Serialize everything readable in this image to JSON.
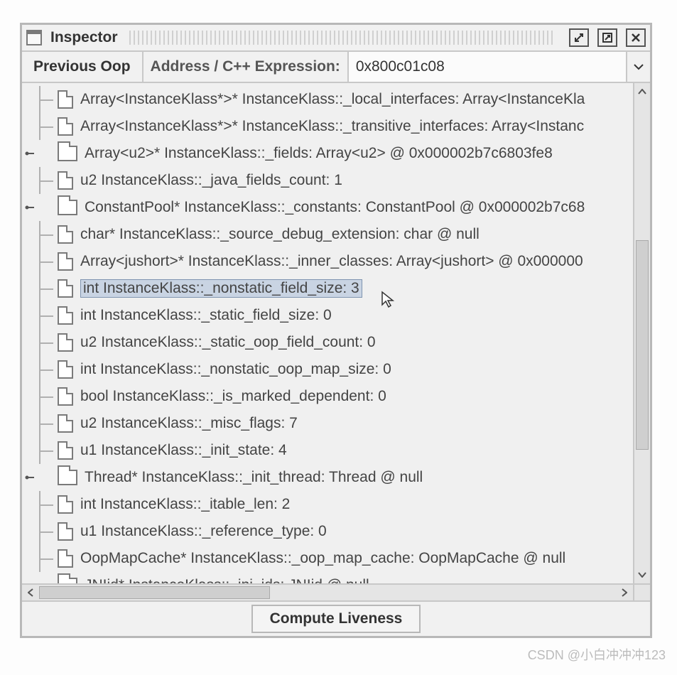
{
  "window": {
    "title": "Inspector"
  },
  "toolbar": {
    "prev_label": "Previous Oop",
    "addr_label": "Address / C++ Expression:",
    "addr_value": "0x800c01c08"
  },
  "tree": {
    "nodes": [
      {
        "icon": "file",
        "expandable": false,
        "selected": false,
        "label": "Array<InstanceKlass*>* InstanceKlass::_local_interfaces: Array<InstanceKla"
      },
      {
        "icon": "file",
        "expandable": false,
        "selected": false,
        "label": "Array<InstanceKlass*>* InstanceKlass::_transitive_interfaces: Array<Instanc"
      },
      {
        "icon": "folder",
        "expandable": true,
        "selected": false,
        "label": "Array<u2>* InstanceKlass::_fields: Array<u2> @ 0x000002b7c6803fe8"
      },
      {
        "icon": "file",
        "expandable": false,
        "selected": false,
        "label": "u2 InstanceKlass::_java_fields_count: 1"
      },
      {
        "icon": "folder",
        "expandable": true,
        "selected": false,
        "label": "ConstantPool* InstanceKlass::_constants: ConstantPool @ 0x000002b7c68"
      },
      {
        "icon": "file",
        "expandable": false,
        "selected": false,
        "label": "char* InstanceKlass::_source_debug_extension: char @ null"
      },
      {
        "icon": "file",
        "expandable": false,
        "selected": false,
        "label": "Array<jushort>* InstanceKlass::_inner_classes: Array<jushort> @ 0x000000"
      },
      {
        "icon": "file",
        "expandable": false,
        "selected": true,
        "label": "int InstanceKlass::_nonstatic_field_size: 3"
      },
      {
        "icon": "file",
        "expandable": false,
        "selected": false,
        "label": "int InstanceKlass::_static_field_size: 0"
      },
      {
        "icon": "file",
        "expandable": false,
        "selected": false,
        "label": "u2 InstanceKlass::_static_oop_field_count: 0"
      },
      {
        "icon": "file",
        "expandable": false,
        "selected": false,
        "label": "int InstanceKlass::_nonstatic_oop_map_size: 0"
      },
      {
        "icon": "file",
        "expandable": false,
        "selected": false,
        "label": "bool InstanceKlass::_is_marked_dependent: 0"
      },
      {
        "icon": "file",
        "expandable": false,
        "selected": false,
        "label": "u2 InstanceKlass::_misc_flags: 7"
      },
      {
        "icon": "file",
        "expandable": false,
        "selected": false,
        "label": "u1 InstanceKlass::_init_state: 4"
      },
      {
        "icon": "folder",
        "expandable": true,
        "selected": false,
        "label": "Thread* InstanceKlass::_init_thread: Thread @ null"
      },
      {
        "icon": "file",
        "expandable": false,
        "selected": false,
        "label": "int InstanceKlass::_itable_len: 2"
      },
      {
        "icon": "file",
        "expandable": false,
        "selected": false,
        "label": "u1 InstanceKlass::_reference_type: 0"
      },
      {
        "icon": "file",
        "expandable": false,
        "selected": false,
        "label": "OopMapCache* InstanceKlass::_oop_map_cache: OopMapCache @ null"
      },
      {
        "icon": "folder",
        "expandable": true,
        "selected": false,
        "label": "JNIid* InstanceKlass::_jni_ids: JNIid @ null"
      }
    ]
  },
  "footer": {
    "compute_label": "Compute Liveness"
  },
  "watermark": "CSDN @小白冲冲冲123"
}
